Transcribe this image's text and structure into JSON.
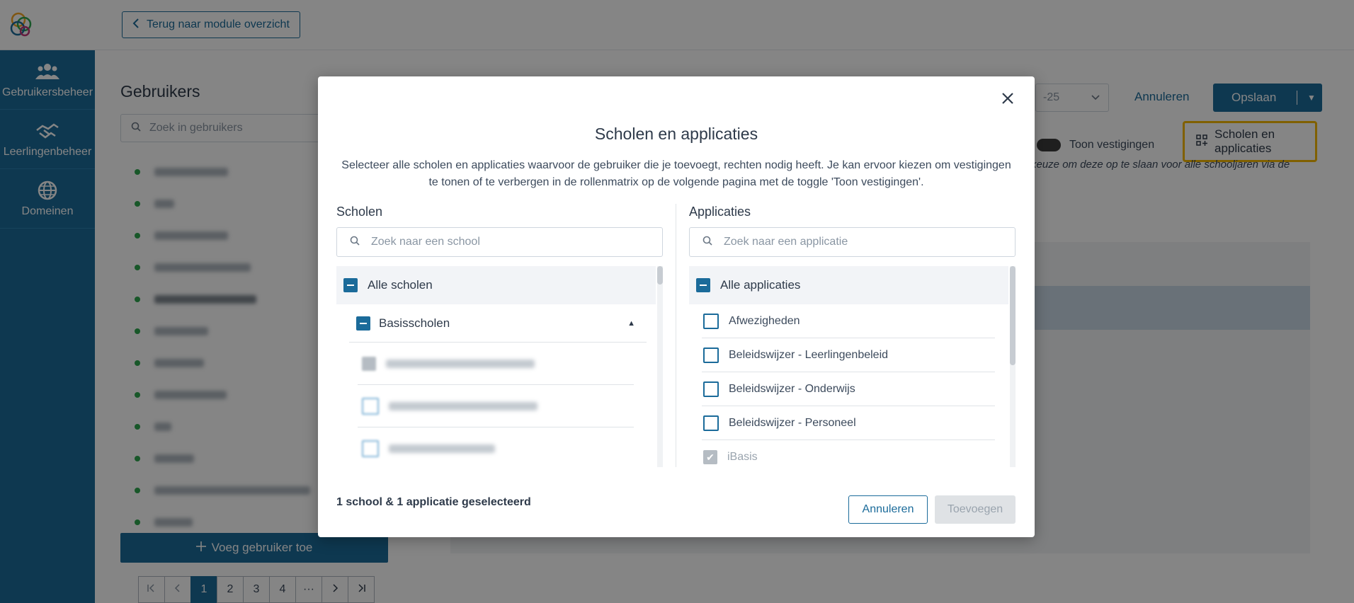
{
  "topbar": {
    "back_label": "Terug naar module overzicht"
  },
  "sidebar": {
    "items": [
      {
        "label": "Gebruikersbeheer",
        "icon": "users-icon"
      },
      {
        "label": "Leerlingenbeheer",
        "icon": "handshake-icon"
      },
      {
        "label": "Domeinen",
        "icon": "globe-icon"
      }
    ]
  },
  "users_panel": {
    "title": "Gebruikers",
    "search_placeholder": "Zoek in gebruikers",
    "add_user_label": "Voeg gebruiker toe",
    "pagination": [
      "1",
      "2",
      "3",
      "4",
      "···"
    ],
    "current_page": "1"
  },
  "main": {
    "school_year": "-25",
    "cancel_label": "Annuleren",
    "save_label": "Opslaan",
    "toggle_label": "Toon vestigingen",
    "schools_apps_button": "Scholen en applicaties",
    "hint_text": "keuze om deze op te slaan voor alle schooljaren via de"
  },
  "modal": {
    "title": "Scholen en applicaties",
    "description": "Selecteer alle scholen en applicaties waarvoor de gebruiker die je toevoegt, rechten nodig heeft. Je kan ervoor kiezen om vestigingen te tonen of te verbergen in de rollenmatrix op de volgende pagina met de toggle 'Toon vestigingen'.",
    "schools": {
      "title": "Scholen",
      "search_placeholder": "Zoek naar een school",
      "all_label": "Alle scholen",
      "group_label": "Basisscholen"
    },
    "apps": {
      "title": "Applicaties",
      "search_placeholder": "Zoek naar een applicatie",
      "all_label": "Alle applicaties",
      "items": [
        "Afwezigheden",
        "Beleidswijzer - Leerlingenbeleid",
        "Beleidswijzer - Onderwijs",
        "Beleidswijzer - Personeel",
        "iBasis"
      ]
    },
    "selection_summary": "1 school & 1 applicatie geselecteerd",
    "cancel_label": "Annuleren",
    "add_label": "Toevoegen"
  },
  "colors": {
    "primary": "#1b6b9a",
    "highlight": "#f5b800",
    "status_active": "#2fa84f"
  }
}
